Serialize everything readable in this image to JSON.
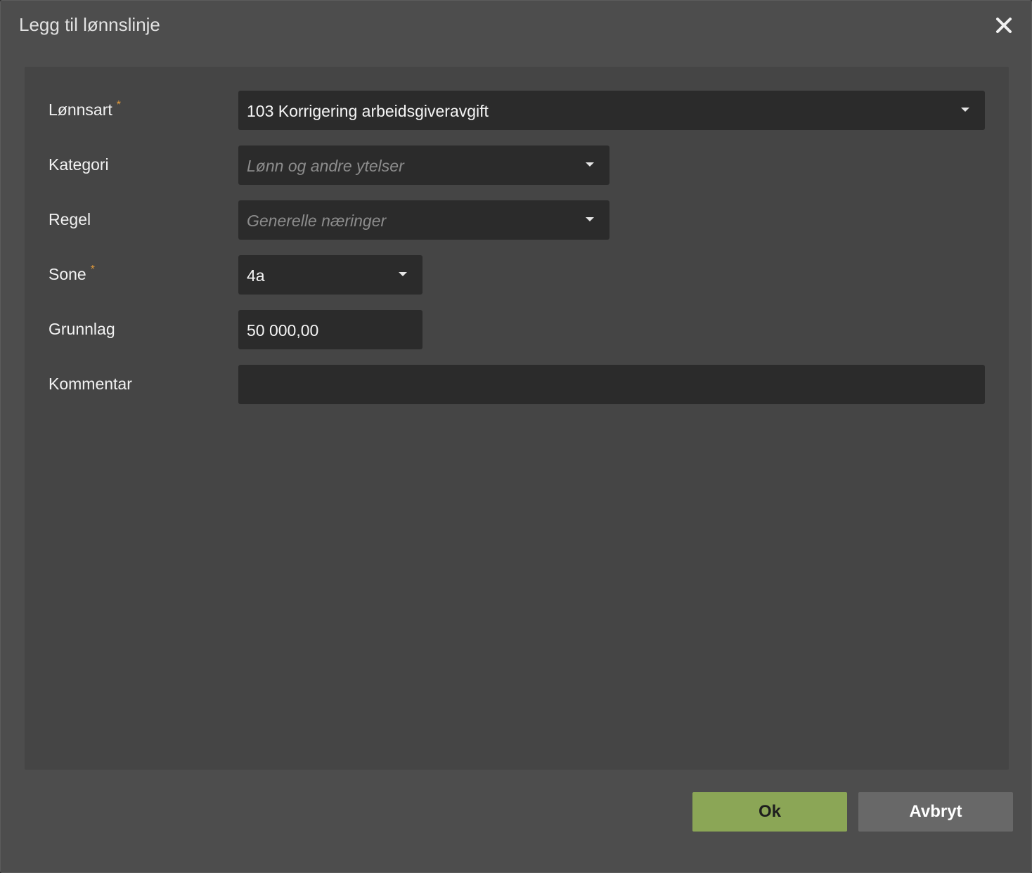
{
  "dialog": {
    "title": "Legg til lønnslinje",
    "close_icon": "close-icon"
  },
  "form": {
    "required_marker": "*",
    "lonnsart": {
      "label": "Lønnsart",
      "required": true,
      "value": "103 Korrigering arbeidsgiveravgift"
    },
    "kategori": {
      "label": "Kategori",
      "placeholder": "Lønn og andre ytelser"
    },
    "regel": {
      "label": "Regel",
      "placeholder": "Generelle næringer"
    },
    "sone": {
      "label": "Sone",
      "required": true,
      "value": "4a"
    },
    "grunnlag": {
      "label": "Grunnlag",
      "value": "50 000,00"
    },
    "kommentar": {
      "label": "Kommentar",
      "value": ""
    }
  },
  "buttons": {
    "ok_label": "Ok",
    "cancel_label": "Avbryt"
  },
  "colors": {
    "dialog_bg": "#4d4d4d",
    "panel_bg": "#454545",
    "field_bg": "#2b2b2b",
    "required_marker": "#e09a3c",
    "ok_button": "#8ba656",
    "cancel_button": "#686868"
  },
  "icons": [
    "close-icon",
    "chevron-down-icon"
  ]
}
